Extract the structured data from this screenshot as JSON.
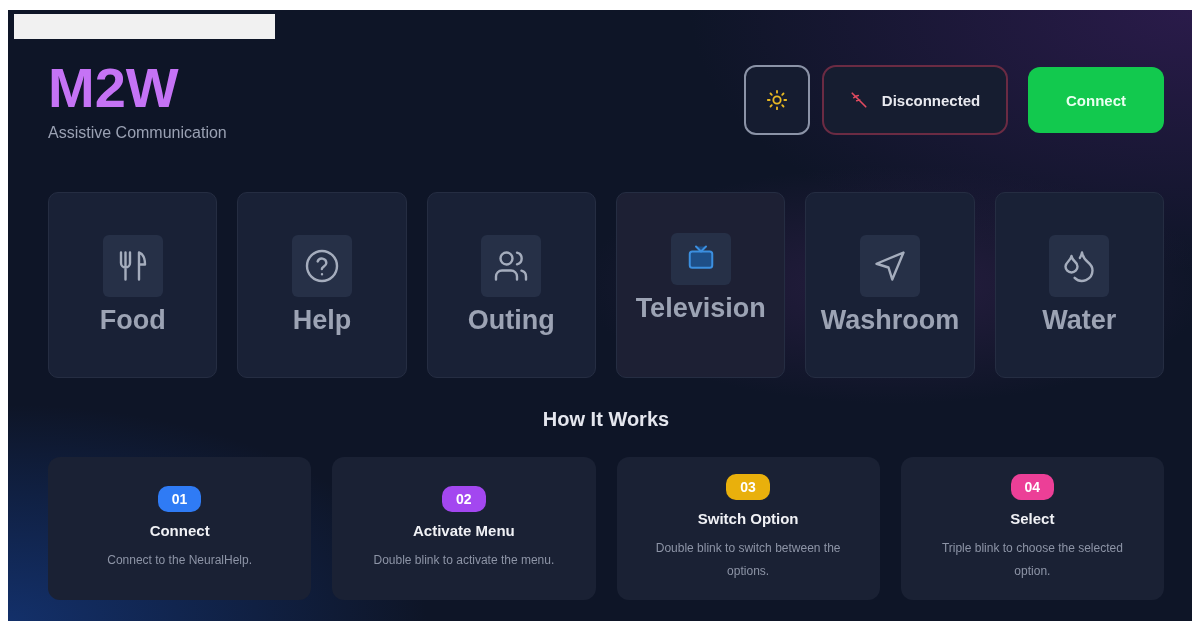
{
  "brand": {
    "logo": "M2W",
    "tagline": "Assistive Communication"
  },
  "header": {
    "status": {
      "label": "Disconnected",
      "connected": false
    },
    "connect_button": "Connect"
  },
  "options": [
    {
      "label": "Food",
      "selected": false
    },
    {
      "label": "Help",
      "selected": false
    },
    {
      "label": "Outing",
      "selected": false
    },
    {
      "label": "Television",
      "selected": true
    },
    {
      "label": "Washroom",
      "selected": false
    },
    {
      "label": "Water",
      "selected": false
    }
  ],
  "how_it_works": {
    "title": "How It Works",
    "steps": [
      {
        "number": "01",
        "title": "Connect",
        "text": "Connect to the NeuralHelp.",
        "color": "#2f7bf5"
      },
      {
        "number": "02",
        "title": "Activate Menu",
        "text": "Double blink to activate the menu.",
        "color": "#a347f0"
      },
      {
        "number": "03",
        "title": "Switch Option",
        "text": "Double blink to switch between the options.",
        "color": "#e9b00c"
      },
      {
        "number": "04",
        "title": "Select",
        "text": "Triple blink to choose the selected option.",
        "color": "#ec3f97"
      }
    ]
  }
}
